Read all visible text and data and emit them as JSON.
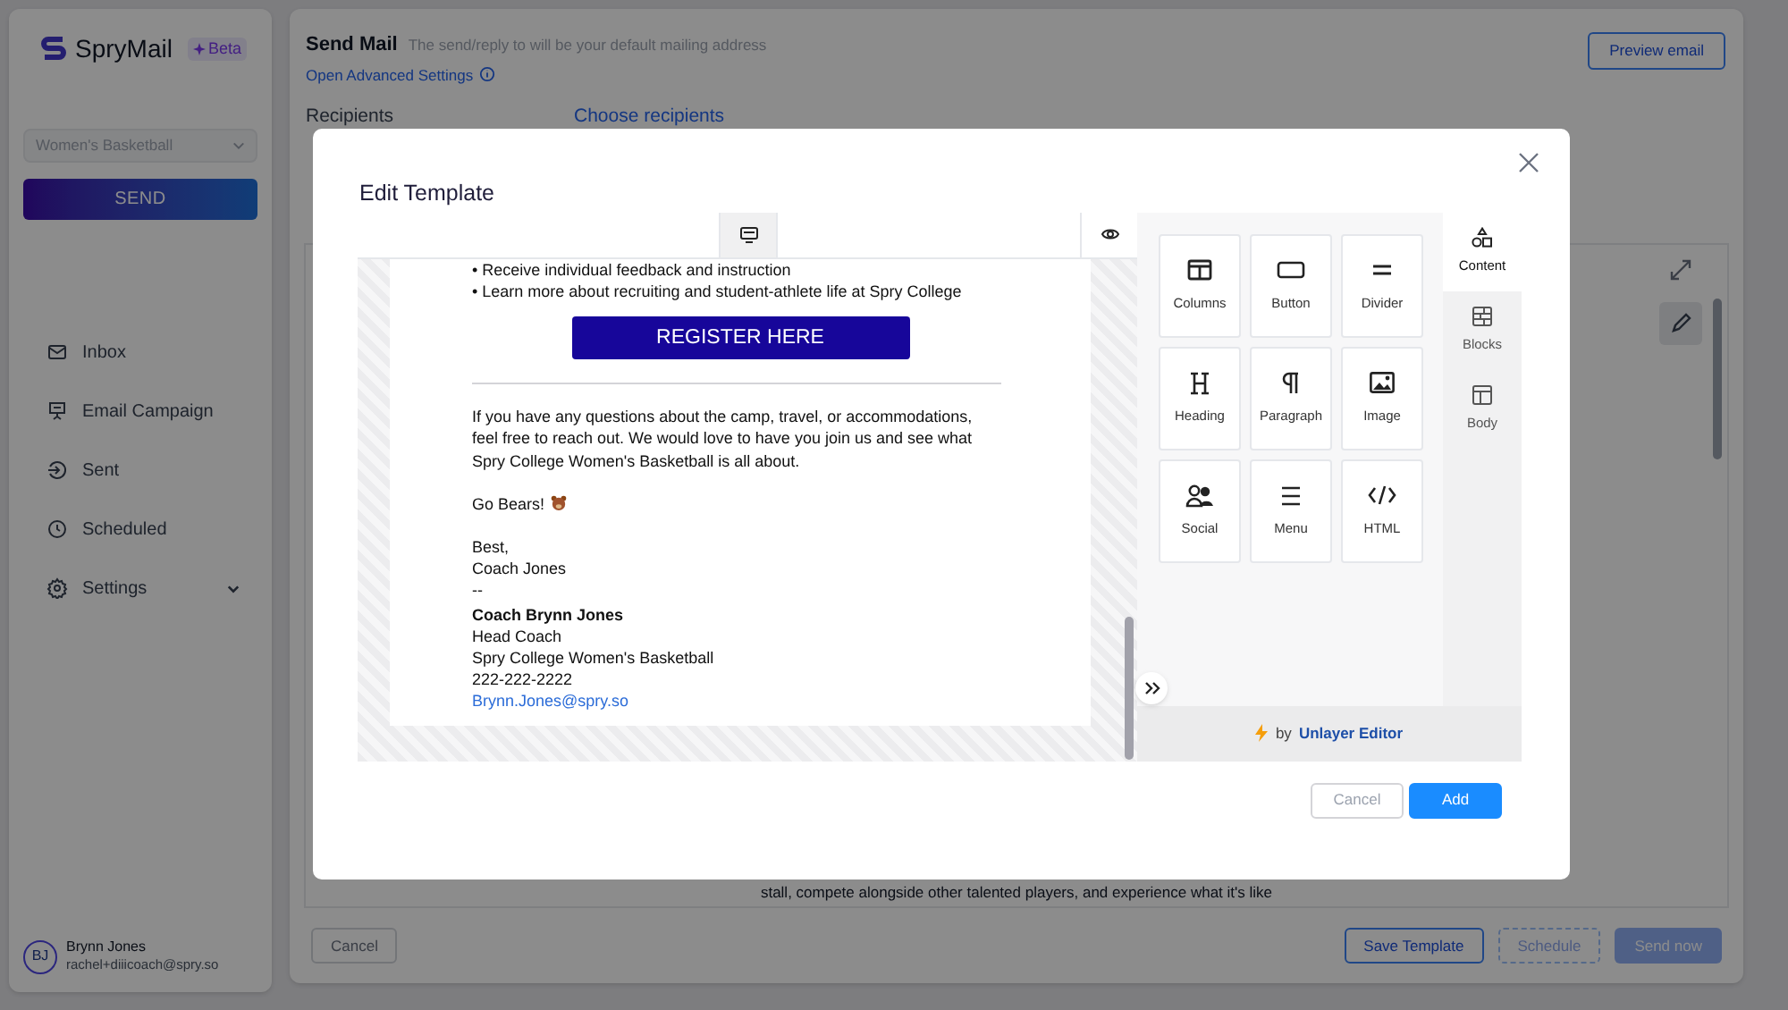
{
  "sidebar": {
    "brand": "SpryMail",
    "badge": "Beta",
    "team_select": "Women's Basketball",
    "send_button": "SEND",
    "nav": [
      {
        "label": "Inbox",
        "has_submenu": false
      },
      {
        "label": "Email Campaign",
        "has_submenu": false
      },
      {
        "label": "Sent",
        "has_submenu": false
      },
      {
        "label": "Scheduled",
        "has_submenu": false
      },
      {
        "label": "Settings",
        "has_submenu": true
      }
    ],
    "user": {
      "initials": "BJ",
      "name": "Brynn Jones",
      "email": "rachel+diiicoach@spry.so"
    }
  },
  "main": {
    "title": "Send Mail",
    "subtitle": "The send/reply to will be your default mailing address",
    "advanced_link": "Open Advanced Settings",
    "preview_button": "Preview email",
    "fields": [
      {
        "label": "Recipients",
        "value": "Choose recipients"
      }
    ],
    "body_line": "stall, compete alongside other talented players, and experience what it's like",
    "buttons": [
      {
        "label": "Cancel",
        "kind": "outline",
        "disabled": false
      },
      {
        "label": "Save Template",
        "kind": "primary-outline",
        "disabled": false
      },
      {
        "label": "Schedule",
        "kind": "primary-outline",
        "disabled": true
      },
      {
        "label": "Send now",
        "kind": "primary",
        "disabled": true
      }
    ]
  },
  "modal": {
    "title": "Edit Template",
    "desktop_view_selected": true,
    "email": {
      "bullets": [
        "• Receive individual feedback and instruction",
        "• Learn more about recruiting and student-athlete life at Spry College"
      ],
      "register_button": "REGISTER HERE",
      "paragraph": "If you have any questions about the camp, travel, or accommodations, feel free to reach out. We would love to have you join us and see what Spry College Women's Basketball is all about.",
      "cheer": "Go Bears!",
      "signoff": [
        "Best,",
        "Coach Jones",
        "--"
      ],
      "signature": [
        {
          "text": "Coach Brynn Jones",
          "bold": true,
          "link": false
        },
        {
          "text": "Head Coach",
          "bold": false,
          "link": false
        },
        {
          "text": "Spry College Women's Basketball",
          "bold": false,
          "link": false
        },
        {
          "text": "222-222-2222",
          "bold": false,
          "link": false
        },
        {
          "text": "Brynn.Jones@spry.so",
          "bold": false,
          "link": true
        }
      ]
    },
    "tools": [
      "Columns",
      "Button",
      "Divider",
      "Heading",
      "Paragraph",
      "Image",
      "Social",
      "Menu",
      "HTML"
    ],
    "side_tabs": [
      {
        "label": "Content",
        "selected": true
      },
      {
        "label": "Blocks",
        "selected": false
      },
      {
        "label": "Body",
        "selected": false
      }
    ],
    "credit_by": "by",
    "credit_name": "Unlayer Editor",
    "buttons": [
      {
        "label": "Cancel",
        "kind": "secondary"
      },
      {
        "label": "Add",
        "kind": "primary"
      }
    ]
  }
}
